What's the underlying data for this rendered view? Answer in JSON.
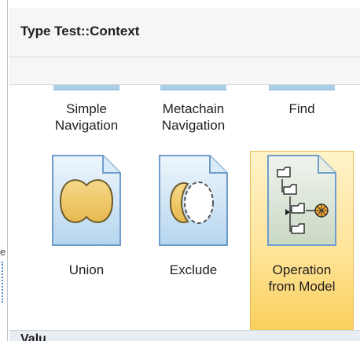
{
  "window": {
    "title": "Type Test::Context",
    "footer_label": "Valu"
  },
  "sidebar": {
    "glyph": "e"
  },
  "palette": {
    "items": [
      {
        "id": "simple-navigation",
        "label_lines": [
          "Simple",
          "Navigation"
        ]
      },
      {
        "id": "metachain-navigation",
        "label_lines": [
          "Metachain",
          "Navigation"
        ]
      },
      {
        "id": "find",
        "label_lines": [
          "Find"
        ]
      },
      {
        "id": "union",
        "label_lines": [
          "Union"
        ]
      },
      {
        "id": "exclude",
        "label_lines": [
          "Exclude"
        ]
      },
      {
        "id": "operation-from-model",
        "label_lines": [
          "Operation",
          "from Model"
        ],
        "selected": true
      }
    ]
  },
  "colors": {
    "selection_top": "#fff3c9",
    "selection_bottom": "#f9cf5b",
    "icon_blue": "#a9cfe9",
    "icon_yellow": "#f2cc6a"
  }
}
